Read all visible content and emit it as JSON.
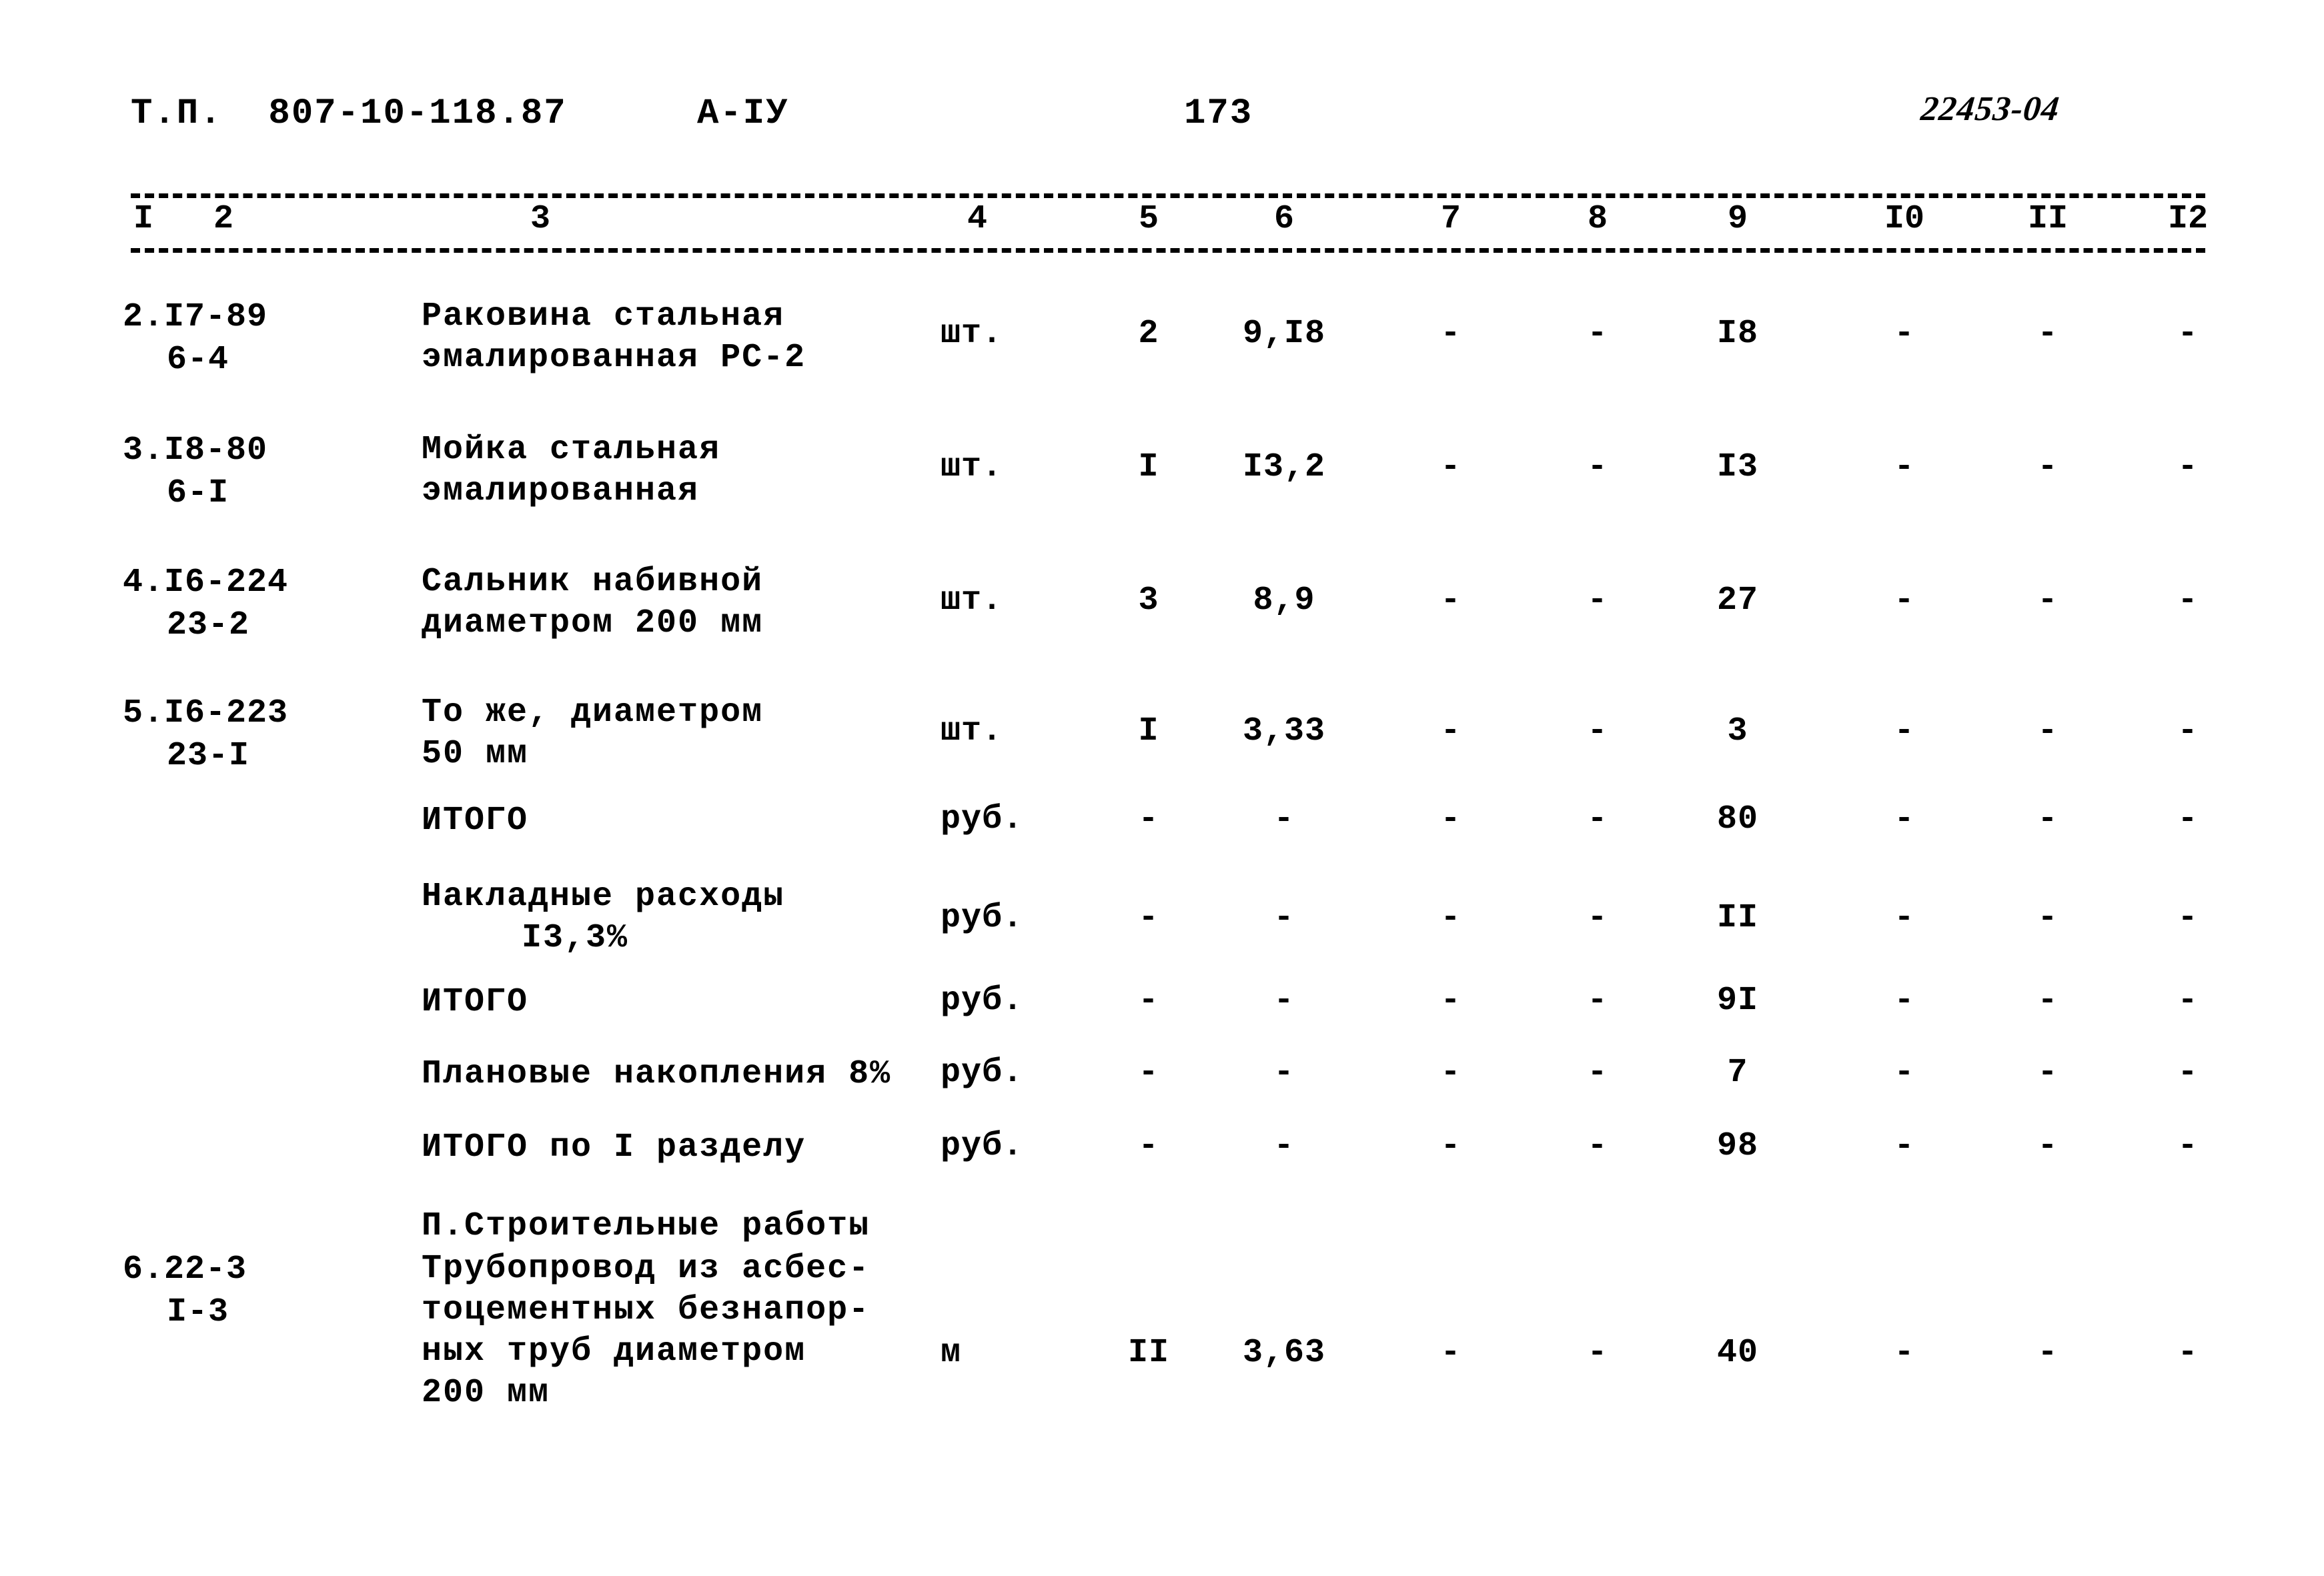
{
  "header": {
    "doc_code": "Т.П.  807-10-118.87",
    "album": "А-IУ",
    "page_number": "173",
    "stamp": "22453-04"
  },
  "table": {
    "column_numbers": [
      "I",
      "2",
      "3",
      "4",
      "5",
      "6",
      "7",
      "8",
      "9",
      "I0",
      "II",
      "I2"
    ],
    "rows": [
      {
        "code_line1": "2.I7-89",
        "code_line2": "6-4",
        "desc_line1": "Раковина стальная",
        "desc_line2": "эмалированная РС-2",
        "desc_line3": "",
        "desc_line4": "",
        "unit": "шт.",
        "c5": "2",
        "c6": "9,I8",
        "c7": "-",
        "c8": "-",
        "c9": "I8",
        "c10": "-",
        "c11": "-",
        "c12": "-"
      },
      {
        "code_line1": "3.I8-80",
        "code_line2": "6-I",
        "desc_line1": "Мойка стальная",
        "desc_line2": "эмалированная",
        "desc_line3": "",
        "desc_line4": "",
        "unit": "шт.",
        "c5": "I",
        "c6": "I3,2",
        "c7": "-",
        "c8": "-",
        "c9": "I3",
        "c10": "-",
        "c11": "-",
        "c12": "-"
      },
      {
        "code_line1": "4.I6-224",
        "code_line2": "23-2",
        "desc_line1": "Сальник набивной",
        "desc_line2": "диаметром 200 мм",
        "desc_line3": "",
        "desc_line4": "",
        "unit": "шт.",
        "c5": "3",
        "c6": "8,9",
        "c7": "-",
        "c8": "-",
        "c9": "27",
        "c10": "-",
        "c11": "-",
        "c12": "-"
      },
      {
        "code_line1": "5.I6-223",
        "code_line2": "23-I",
        "desc_line1": "То же, диаметром",
        "desc_line2": "50 мм",
        "desc_line3": "",
        "desc_line4": "",
        "unit": "шт.",
        "c5": "I",
        "c6": "3,33",
        "c7": "-",
        "c8": "-",
        "c9": "3",
        "c10": "-",
        "c11": "-",
        "c12": "-"
      },
      {
        "code_line1": "",
        "code_line2": "",
        "desc_line1": "ИТОГО",
        "desc_line2": "",
        "desc_line3": "",
        "desc_line4": "",
        "unit": "руб.",
        "c5": "-",
        "c6": "-",
        "c7": "-",
        "c8": "-",
        "c9": "80",
        "c10": "-",
        "c11": "-",
        "c12": "-"
      },
      {
        "code_line1": "",
        "code_line2": "",
        "desc_line1": "Накладные расходы",
        "desc_line2": "I3,3%",
        "desc_line3": "",
        "desc_line4": "",
        "desc_line2_indent": true,
        "unit": "руб.",
        "c5": "-",
        "c6": "-",
        "c7": "-",
        "c8": "-",
        "c9": "II",
        "c10": "-",
        "c11": "-",
        "c12": "-"
      },
      {
        "code_line1": "",
        "code_line2": "",
        "desc_line1": "ИТОГО",
        "desc_line2": "",
        "desc_line3": "",
        "desc_line4": "",
        "unit": "руб.",
        "c5": "-",
        "c6": "-",
        "c7": "-",
        "c8": "-",
        "c9": "9I",
        "c10": "-",
        "c11": "-",
        "c12": "-"
      },
      {
        "code_line1": "",
        "code_line2": "",
        "desc_line1": "Плановые накопления 8%",
        "desc_line2": "",
        "desc_line3": "",
        "desc_line4": "",
        "unit": "руб.",
        "c5": "-",
        "c6": "-",
        "c7": "-",
        "c8": "-",
        "c9": "7",
        "c10": "-",
        "c11": "-",
        "c12": "-"
      },
      {
        "code_line1": "",
        "code_line2": "",
        "desc_line1": "ИТОГО по I разделу",
        "desc_line2": "",
        "desc_line3": "",
        "desc_line4": "",
        "unit": "руб.",
        "c5": "-",
        "c6": "-",
        "c7": "-",
        "c8": "-",
        "c9": "98",
        "c10": "-",
        "c11": "-",
        "c12": "-"
      },
      {
        "code_line1": "",
        "code_line2": "",
        "desc_line1": "П.Строительные работы",
        "desc_line2": "",
        "desc_line3": "",
        "desc_line4": "",
        "unit": "",
        "c5": "",
        "c6": "",
        "c7": "",
        "c8": "",
        "c9": "",
        "c10": "",
        "c11": "",
        "c12": ""
      },
      {
        "code_line1": "6.22-3",
        "code_line2": "I-3",
        "desc_line1": "Трубопровод из асбес-",
        "desc_line2": "тоцементных безнапор-",
        "desc_line3": "ных труб диаметром",
        "desc_line4": "200 мм",
        "unit": "м",
        "c5": "II",
        "c6": "3,63",
        "c7": "-",
        "c8": "-",
        "c9": "40",
        "c10": "-",
        "c11": "-",
        "c12": "-"
      }
    ]
  }
}
